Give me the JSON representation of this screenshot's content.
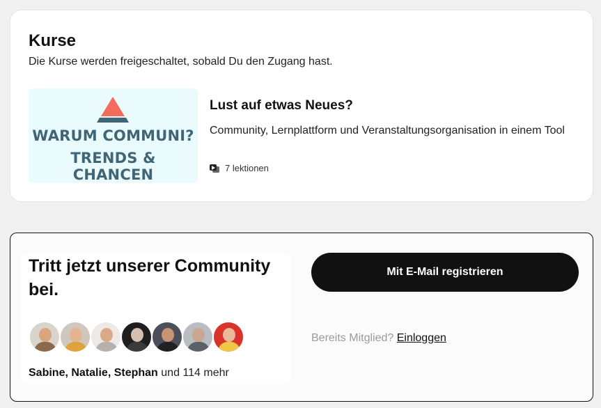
{
  "courses": {
    "title": "Kurse",
    "subtitle": "Die Kurse werden freigeschaltet, sobald Du den Zugang hast.",
    "items": [
      {
        "thumb_line1": "WARUM COMMUNI?",
        "thumb_line2": "TRENDS & CHANCEN",
        "title": "Lust auf etwas Neues?",
        "description": "Community, Lernplattform und Veranstaltungsorganisation in einem Tool",
        "lessons": "7 lektionen",
        "lesson_icon": "video-lessons-icon"
      }
    ]
  },
  "join": {
    "title": "Tritt jetzt unserer Community bei.",
    "member_names": "Sabine, Natalie, Stephan",
    "member_more": " und 114 mehr",
    "register_label": "Mit E-Mail registrieren",
    "already_member": "Bereits Mitglied? ",
    "login_label": "Einloggen"
  },
  "colors": {
    "thumb_text": "#3f6576",
    "thumb_bg": "#eafbfd",
    "logo_top": "#f26b5b",
    "logo_base": "#3f6576",
    "button_bg": "#111111"
  }
}
